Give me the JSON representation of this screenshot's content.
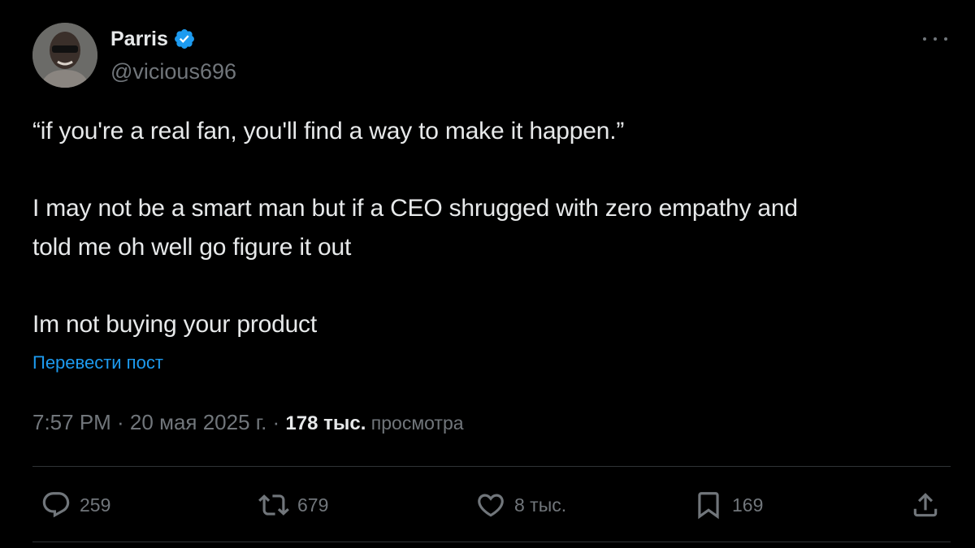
{
  "author": {
    "name": "Parris",
    "handle": "@vicious696",
    "verified": true,
    "verified_color": "#1d9bf0"
  },
  "post": {
    "lines": [
      "“if you're a real fan, you'll find a way to make it happen.”",
      "I may not be a smart man but if a CEO shrugged with zero empathy and",
      "told me oh well go figure it out",
      "Im not buying your product"
    ],
    "translate_link": "Перевести пост"
  },
  "meta": {
    "time": "7:57 PM · 20 мая 2025 г. · ",
    "views_count": "178 тыс.",
    "views_label": " просмотра"
  },
  "actions": {
    "replies": "259",
    "reposts": "679",
    "likes": "8 тыс.",
    "bookmarks": "169"
  },
  "icons": {
    "verified": "verified-badge-icon",
    "more": "more-options-icon",
    "reply": "reply-icon",
    "repost": "repost-icon",
    "like": "heart-icon",
    "bookmark": "bookmark-icon",
    "share": "share-icon"
  },
  "colors": {
    "background": "#000000",
    "text": "#e7e9ea",
    "secondary": "#71767b",
    "link": "#1d9bf0",
    "divider": "#2f3336"
  }
}
